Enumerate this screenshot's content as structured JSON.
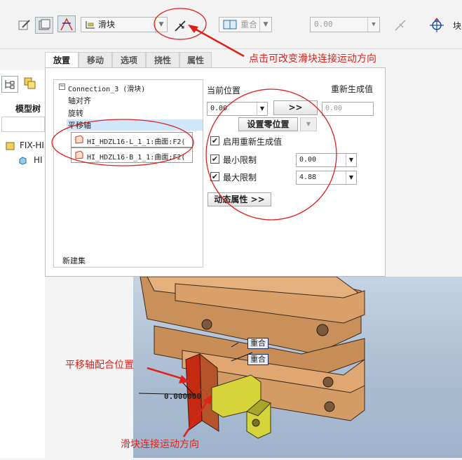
{
  "toolbar": {
    "constraint_type": "滑块",
    "coincident_label": "重合",
    "offset_value": "0.00",
    "right_label": "块"
  },
  "tabs": [
    "放置",
    "移动",
    "选项",
    "挠性",
    "属性"
  ],
  "tree": {
    "connection": "Connection_3 (滑块)",
    "items": [
      "轴对齐",
      "旋转",
      "平移轴"
    ],
    "refs": [
      "HI_HDZL16-L_1_1:曲面:F2(",
      "HI_HDZL16-B_1_1:曲面:F2("
    ],
    "new_set": "新建集"
  },
  "props": {
    "current_position_label": "当前位置",
    "regen_value_label": "重新生成值",
    "current_value": "0.00",
    "jump_button": ">>",
    "regen_value": "0.00",
    "set_zero_button": "设置零位置",
    "enable_regen_label": "启用重新生成值",
    "min_limit_label": "最小限制",
    "min_limit_value": "0.00",
    "max_limit_label": "最大限制",
    "max_limit_value": "4.88",
    "dynamic_props_button": "动态属性 >>"
  },
  "left": {
    "model_tree": "模型树",
    "root_item": "FIX-HI",
    "child_item": "HI"
  },
  "viewport": {
    "label1": "重合",
    "label2": "重合",
    "dim_value": "0.000000"
  },
  "annotations": {
    "direction_button_note": "点击可改变滑块连接运动方向",
    "axis_position_note": "平移轴配合位置",
    "direction_note": "滑块连接运动方向"
  },
  "colors": {
    "annotation_red": "#e0201b",
    "part_orange": "#d9a06a",
    "slider_yellow": "#d6d43a",
    "tree_highlight": "#cfe6fb"
  }
}
